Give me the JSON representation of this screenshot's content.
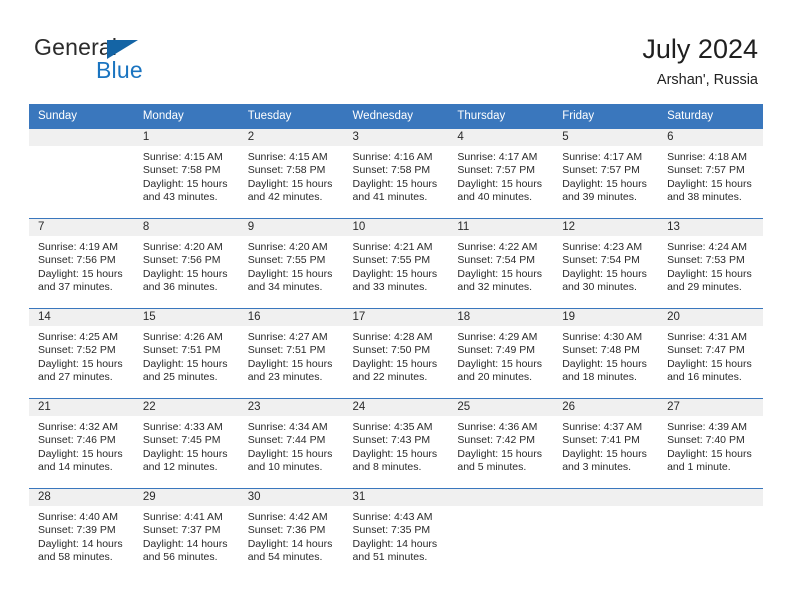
{
  "brand": {
    "word1": "General",
    "word2": "Blue",
    "triangle_icon": "triangle-icon",
    "color_dark": "#2b2b2b",
    "color_blue": "#1a74c0"
  },
  "header": {
    "title": "July 2024",
    "subtitle": "Arshan', Russia"
  },
  "theme": {
    "header_bg": "#3a77bd",
    "header_text": "#ffffff",
    "daynum_bg": "#f0f0f0",
    "cell_bg": "#ffffff",
    "grid_line": "#3a77bd",
    "body_text": "#2a2a2a"
  },
  "weekdays": [
    "Sunday",
    "Monday",
    "Tuesday",
    "Wednesday",
    "Thursday",
    "Friday",
    "Saturday"
  ],
  "weeks": [
    [
      {
        "day": "",
        "lines": []
      },
      {
        "day": "1",
        "lines": [
          "Sunrise: 4:15 AM",
          "Sunset: 7:58 PM",
          "Daylight: 15 hours",
          "and 43 minutes."
        ]
      },
      {
        "day": "2",
        "lines": [
          "Sunrise: 4:15 AM",
          "Sunset: 7:58 PM",
          "Daylight: 15 hours",
          "and 42 minutes."
        ]
      },
      {
        "day": "3",
        "lines": [
          "Sunrise: 4:16 AM",
          "Sunset: 7:58 PM",
          "Daylight: 15 hours",
          "and 41 minutes."
        ]
      },
      {
        "day": "4",
        "lines": [
          "Sunrise: 4:17 AM",
          "Sunset: 7:57 PM",
          "Daylight: 15 hours",
          "and 40 minutes."
        ]
      },
      {
        "day": "5",
        "lines": [
          "Sunrise: 4:17 AM",
          "Sunset: 7:57 PM",
          "Daylight: 15 hours",
          "and 39 minutes."
        ]
      },
      {
        "day": "6",
        "lines": [
          "Sunrise: 4:18 AM",
          "Sunset: 7:57 PM",
          "Daylight: 15 hours",
          "and 38 minutes."
        ]
      }
    ],
    [
      {
        "day": "7",
        "lines": [
          "Sunrise: 4:19 AM",
          "Sunset: 7:56 PM",
          "Daylight: 15 hours",
          "and 37 minutes."
        ]
      },
      {
        "day": "8",
        "lines": [
          "Sunrise: 4:20 AM",
          "Sunset: 7:56 PM",
          "Daylight: 15 hours",
          "and 36 minutes."
        ]
      },
      {
        "day": "9",
        "lines": [
          "Sunrise: 4:20 AM",
          "Sunset: 7:55 PM",
          "Daylight: 15 hours",
          "and 34 minutes."
        ]
      },
      {
        "day": "10",
        "lines": [
          "Sunrise: 4:21 AM",
          "Sunset: 7:55 PM",
          "Daylight: 15 hours",
          "and 33 minutes."
        ]
      },
      {
        "day": "11",
        "lines": [
          "Sunrise: 4:22 AM",
          "Sunset: 7:54 PM",
          "Daylight: 15 hours",
          "and 32 minutes."
        ]
      },
      {
        "day": "12",
        "lines": [
          "Sunrise: 4:23 AM",
          "Sunset: 7:54 PM",
          "Daylight: 15 hours",
          "and 30 minutes."
        ]
      },
      {
        "day": "13",
        "lines": [
          "Sunrise: 4:24 AM",
          "Sunset: 7:53 PM",
          "Daylight: 15 hours",
          "and 29 minutes."
        ]
      }
    ],
    [
      {
        "day": "14",
        "lines": [
          "Sunrise: 4:25 AM",
          "Sunset: 7:52 PM",
          "Daylight: 15 hours",
          "and 27 minutes."
        ]
      },
      {
        "day": "15",
        "lines": [
          "Sunrise: 4:26 AM",
          "Sunset: 7:51 PM",
          "Daylight: 15 hours",
          "and 25 minutes."
        ]
      },
      {
        "day": "16",
        "lines": [
          "Sunrise: 4:27 AM",
          "Sunset: 7:51 PM",
          "Daylight: 15 hours",
          "and 23 minutes."
        ]
      },
      {
        "day": "17",
        "lines": [
          "Sunrise: 4:28 AM",
          "Sunset: 7:50 PM",
          "Daylight: 15 hours",
          "and 22 minutes."
        ]
      },
      {
        "day": "18",
        "lines": [
          "Sunrise: 4:29 AM",
          "Sunset: 7:49 PM",
          "Daylight: 15 hours",
          "and 20 minutes."
        ]
      },
      {
        "day": "19",
        "lines": [
          "Sunrise: 4:30 AM",
          "Sunset: 7:48 PM",
          "Daylight: 15 hours",
          "and 18 minutes."
        ]
      },
      {
        "day": "20",
        "lines": [
          "Sunrise: 4:31 AM",
          "Sunset: 7:47 PM",
          "Daylight: 15 hours",
          "and 16 minutes."
        ]
      }
    ],
    [
      {
        "day": "21",
        "lines": [
          "Sunrise: 4:32 AM",
          "Sunset: 7:46 PM",
          "Daylight: 15 hours",
          "and 14 minutes."
        ]
      },
      {
        "day": "22",
        "lines": [
          "Sunrise: 4:33 AM",
          "Sunset: 7:45 PM",
          "Daylight: 15 hours",
          "and 12 minutes."
        ]
      },
      {
        "day": "23",
        "lines": [
          "Sunrise: 4:34 AM",
          "Sunset: 7:44 PM",
          "Daylight: 15 hours",
          "and 10 minutes."
        ]
      },
      {
        "day": "24",
        "lines": [
          "Sunrise: 4:35 AM",
          "Sunset: 7:43 PM",
          "Daylight: 15 hours",
          "and 8 minutes."
        ]
      },
      {
        "day": "25",
        "lines": [
          "Sunrise: 4:36 AM",
          "Sunset: 7:42 PM",
          "Daylight: 15 hours",
          "and 5 minutes."
        ]
      },
      {
        "day": "26",
        "lines": [
          "Sunrise: 4:37 AM",
          "Sunset: 7:41 PM",
          "Daylight: 15 hours",
          "and 3 minutes."
        ]
      },
      {
        "day": "27",
        "lines": [
          "Sunrise: 4:39 AM",
          "Sunset: 7:40 PM",
          "Daylight: 15 hours",
          "and 1 minute."
        ]
      }
    ],
    [
      {
        "day": "28",
        "lines": [
          "Sunrise: 4:40 AM",
          "Sunset: 7:39 PM",
          "Daylight: 14 hours",
          "and 58 minutes."
        ]
      },
      {
        "day": "29",
        "lines": [
          "Sunrise: 4:41 AM",
          "Sunset: 7:37 PM",
          "Daylight: 14 hours",
          "and 56 minutes."
        ]
      },
      {
        "day": "30",
        "lines": [
          "Sunrise: 4:42 AM",
          "Sunset: 7:36 PM",
          "Daylight: 14 hours",
          "and 54 minutes."
        ]
      },
      {
        "day": "31",
        "lines": [
          "Sunrise: 4:43 AM",
          "Sunset: 7:35 PM",
          "Daylight: 14 hours",
          "and 51 minutes."
        ]
      },
      {
        "day": "",
        "lines": []
      },
      {
        "day": "",
        "lines": []
      },
      {
        "day": "",
        "lines": []
      }
    ]
  ]
}
